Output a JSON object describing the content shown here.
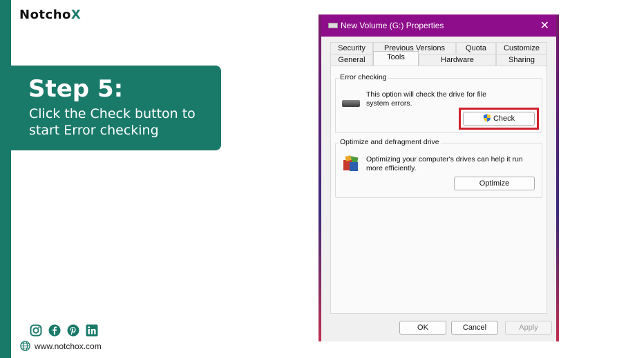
{
  "brand": {
    "logo_text_main": "Notcho",
    "logo_text_accent": "X",
    "accent_color": "#1a7a6a"
  },
  "step": {
    "title": "Step 5:",
    "text": "Click the Check button to start Error checking"
  },
  "social": {
    "icons": [
      "instagram-icon",
      "facebook-icon",
      "pinterest-icon",
      "linkedin-icon"
    ]
  },
  "website": {
    "url": "www.notchox.com"
  },
  "dialog": {
    "title": "New Volume (G:) Properties",
    "titlebar_color": "#8e0d8a",
    "tabs_row1": [
      "Security",
      "Previous Versions",
      "Quota",
      "Customize"
    ],
    "tabs_row2": [
      "General",
      "Tools",
      "Hardware",
      "Sharing"
    ],
    "active_tab": "Tools",
    "error_checking": {
      "label": "Error checking",
      "description": "This option will check the drive for file system errors.",
      "button": "Check"
    },
    "optimize": {
      "label": "Optimize and defragment drive",
      "description": "Optimizing your computer's drives can help it run more efficiently.",
      "button": "Optimize"
    },
    "footer": {
      "ok": "OK",
      "cancel": "Cancel",
      "apply": "Apply"
    }
  }
}
